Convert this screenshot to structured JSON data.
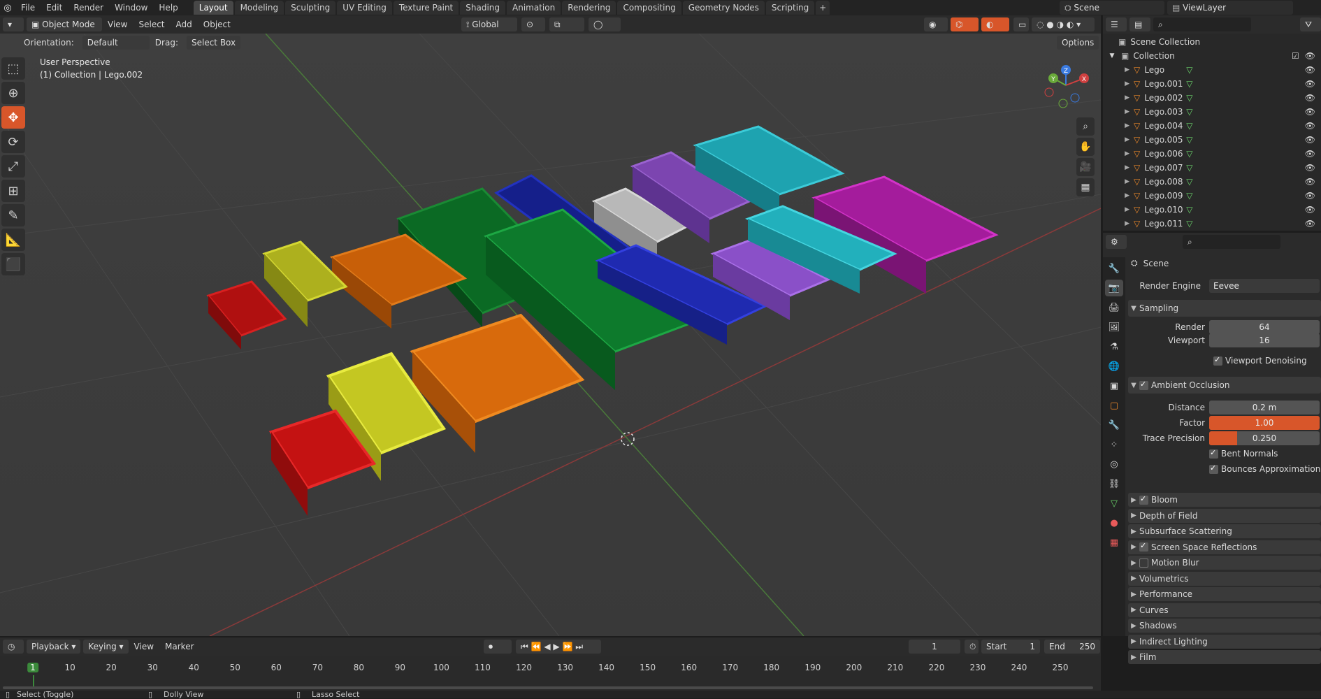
{
  "menu": [
    "File",
    "Edit",
    "Render",
    "Window",
    "Help"
  ],
  "workspaces": [
    "Layout",
    "Modeling",
    "Sculpting",
    "UV Editing",
    "Texture Paint",
    "Shading",
    "Animation",
    "Rendering",
    "Compositing",
    "Geometry Nodes",
    "Scripting"
  ],
  "active_workspace": "Layout",
  "scene_name": "Scene",
  "view_layer": "ViewLayer",
  "header": {
    "mode": "Object Mode",
    "view": "View",
    "select": "Select",
    "add": "Add",
    "object": "Object",
    "transform": "Global",
    "options": "Options"
  },
  "tool_settings": {
    "orientation_label": "Orientation:",
    "orientation_value": "Default",
    "drag_label": "Drag:",
    "drag_value": "Select Box"
  },
  "viewport": {
    "perspective": "User Perspective",
    "collection_info": "(1) Collection | Lego.002",
    "gizmo": {
      "x": "X",
      "y": "Y",
      "z": "Z"
    }
  },
  "outliner": {
    "scene_collection": "Scene Collection",
    "collection": "Collection",
    "objects": [
      "Lego",
      "Lego.001",
      "Lego.002",
      "Lego.003",
      "Lego.004",
      "Lego.005",
      "Lego.006",
      "Lego.007",
      "Lego.008",
      "Lego.009",
      "Lego.010",
      "Lego.011"
    ]
  },
  "properties": {
    "context": "Scene",
    "render_engine_label": "Render Engine",
    "render_engine_value": "Eevee",
    "sampling": {
      "title": "Sampling",
      "render_label": "Render",
      "render_value": "64",
      "viewport_label": "Viewport",
      "viewport_value": "16",
      "denoise_label": "Viewport Denoising"
    },
    "ambient_occlusion": {
      "title": "Ambient Occlusion",
      "distance_label": "Distance",
      "distance_value": "0.2 m",
      "factor_label": "Factor",
      "factor_value": "1.00",
      "factor_fill": 1.0,
      "trace_label": "Trace Precision",
      "trace_value": "0.250",
      "trace_fill": 0.25,
      "bent_normals": "Bent Normals",
      "bounces": "Bounces Approximation"
    },
    "panels": [
      {
        "label": "Bloom",
        "checkbox": "on"
      },
      {
        "label": "Depth of Field",
        "checkbox": "none"
      },
      {
        "label": "Subsurface Scattering",
        "checkbox": "none"
      },
      {
        "label": "Screen Space Reflections",
        "checkbox": "on"
      },
      {
        "label": "Motion Blur",
        "checkbox": "off"
      },
      {
        "label": "Volumetrics",
        "checkbox": "none"
      },
      {
        "label": "Performance",
        "checkbox": "none"
      },
      {
        "label": "Curves",
        "checkbox": "none"
      },
      {
        "label": "Shadows",
        "checkbox": "none"
      },
      {
        "label": "Indirect Lighting",
        "checkbox": "none"
      },
      {
        "label": "Film",
        "checkbox": "none"
      }
    ]
  },
  "timeline": {
    "playback": "Playback",
    "keying": "Keying",
    "view": "View",
    "marker": "Marker",
    "current_frame": "1",
    "start_label": "Start",
    "start_value": "1",
    "end_label": "End",
    "end_value": "250",
    "ticks": [
      "1",
      "10",
      "20",
      "30",
      "40",
      "50",
      "60",
      "70",
      "80",
      "90",
      "100",
      "110",
      "120",
      "130",
      "140",
      "150",
      "160",
      "170",
      "180",
      "190",
      "200",
      "210",
      "220",
      "230",
      "240",
      "250"
    ]
  },
  "status": {
    "select": "Select (Toggle)",
    "dolly": "Dolly View",
    "lasso": "Lasso Select"
  },
  "colors": {
    "accent": "#d8562a",
    "viewport_bg": "#3d3d3d",
    "panel_bg": "#2b2b2b",
    "bricks": [
      "#c41212",
      "#c9cc2a",
      "#e0700a",
      "#0b7a2a",
      "#1a27b0",
      "#2f35c0",
      "#b9b9b9",
      "#8a4fc4",
      "#2ab7c4",
      "#c422b8"
    ]
  }
}
